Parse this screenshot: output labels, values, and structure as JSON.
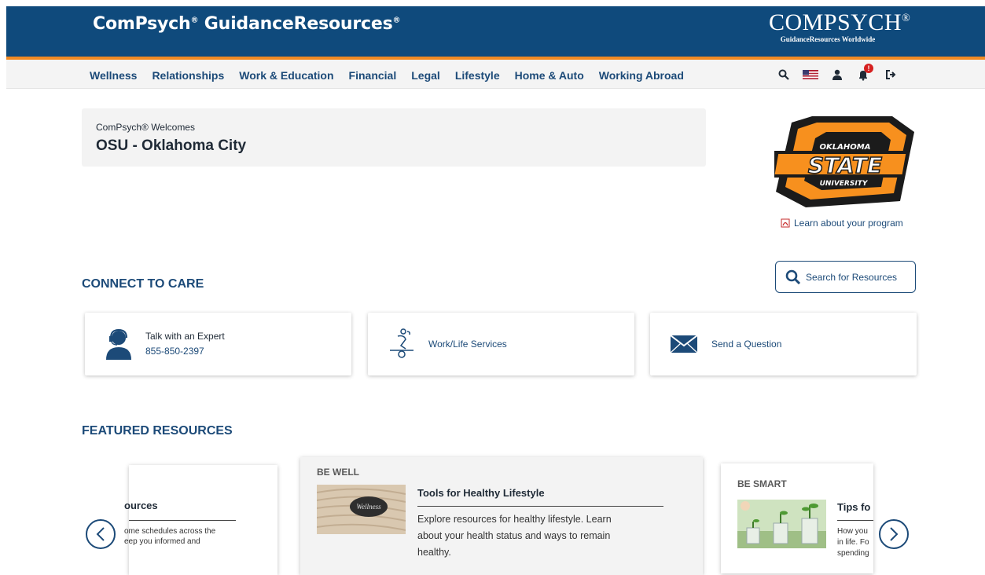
{
  "header": {
    "brand": "ComPsych",
    "brand_suffix": "GuidanceResources",
    "logo_main": "COMPSYCH",
    "logo_sub": "GuidanceResources Worldwide"
  },
  "nav": {
    "items": [
      "Wellness",
      "Relationships",
      "Work & Education",
      "Financial",
      "Legal",
      "Lifestyle",
      "Home & Auto",
      "Working Abroad"
    ],
    "icons": [
      "search-icon",
      "us-flag-icon",
      "user-icon",
      "notification-bell-icon",
      "logout-icon"
    ],
    "notification_badge": "!"
  },
  "welcome": {
    "subtitle": "ComPsych® Welcomes",
    "org_name": "OSU - Oklahoma City"
  },
  "program": {
    "logo_top": "OKLAHOMA",
    "logo_mid": "STATE",
    "logo_bot": "UNIVERSITY",
    "link_label": "Learn about your program"
  },
  "connect": {
    "heading": "CONNECT TO CARE",
    "search_label": "Search for Resources",
    "cards": [
      {
        "title": "Talk with an Expert",
        "phone": "855-850-2397"
      },
      {
        "title": "Work/Life Services"
      },
      {
        "title": "Send a Question"
      }
    ]
  },
  "featured": {
    "heading": "FEATURED RESOURCES",
    "left": {
      "title_fragment": "ources",
      "desc_line1": "ome schedules across the",
      "desc_line2": "eep you informed and"
    },
    "middle": {
      "category": "BE WELL",
      "image_text": "Wellness",
      "title": "Tools for Healthy Lifestyle",
      "desc_line1": "Explore resources for healthy lifestyle. Learn",
      "desc_line2": "about your health status and ways to remain",
      "desc_line3": "healthy."
    },
    "right": {
      "category": "BE SMART",
      "title_fragment": "Tips fo",
      "desc_line1": "How you",
      "desc_line2": "in life. Fo",
      "desc_line3": "spending"
    }
  },
  "colors": {
    "header_bg": "#0f4a7c",
    "accent_orange": "#f08a24",
    "link_blue": "#1c4a78",
    "osu_orange": "#f7901e"
  }
}
